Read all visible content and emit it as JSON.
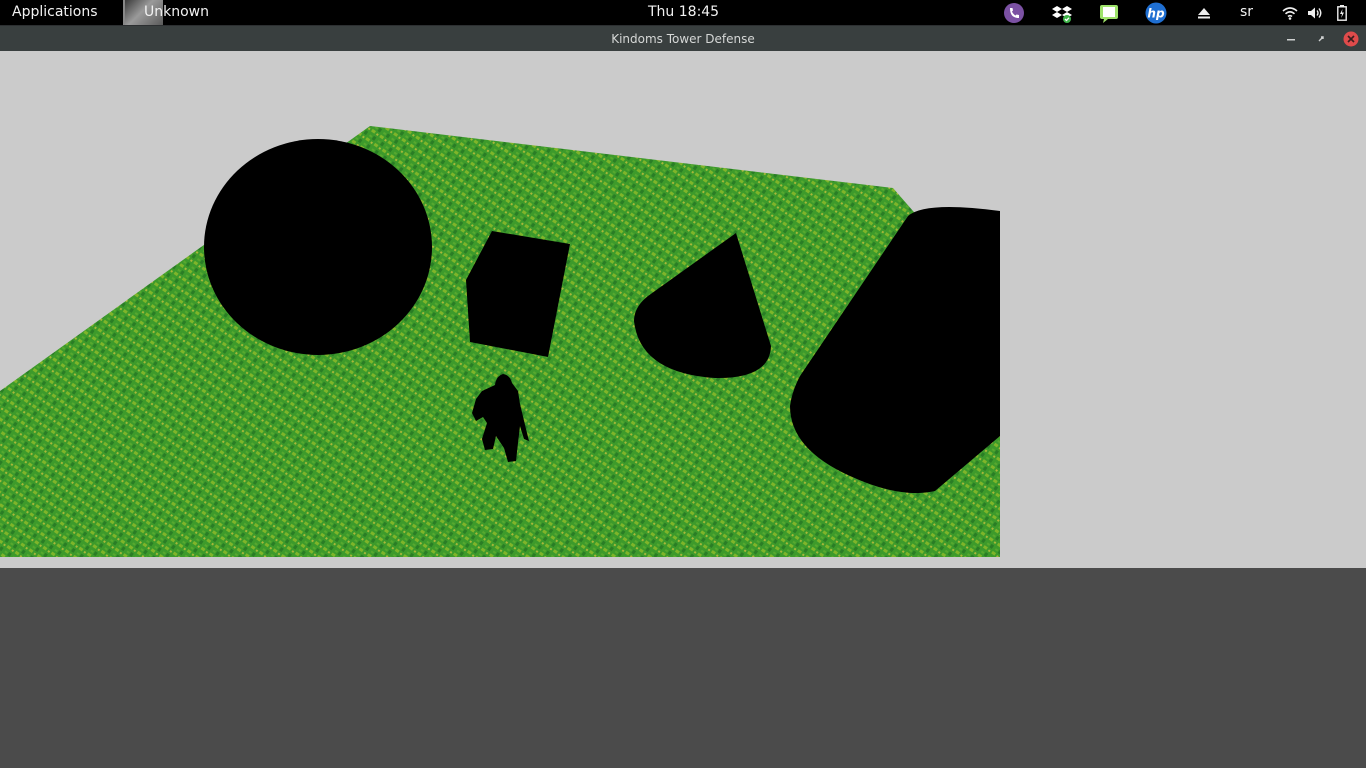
{
  "topbar": {
    "applications_label": "Applications",
    "app_name": "Unknown",
    "clock": "Thu 18:45",
    "user": "sr",
    "tray_icons": [
      "viber-icon",
      "dropbox-icon",
      "chat-icon",
      "hp-icon",
      "eject-icon",
      "wifi-icon",
      "volume-icon",
      "battery-icon"
    ]
  },
  "window": {
    "title": "Kindoms Tower Defense",
    "buttons": [
      "minimize-icon",
      "restore-icon",
      "close-icon"
    ]
  },
  "colors": {
    "topbar_bg": "#000000",
    "titlebar_bg": "#393f3f",
    "client_bg": "#cbcbcb",
    "desktop_bg": "#4b4b4b",
    "grass": "#3f9a2a",
    "viber": "#7b51a3",
    "hp": "#1f6fd2",
    "close_red": "#e04b4b"
  }
}
